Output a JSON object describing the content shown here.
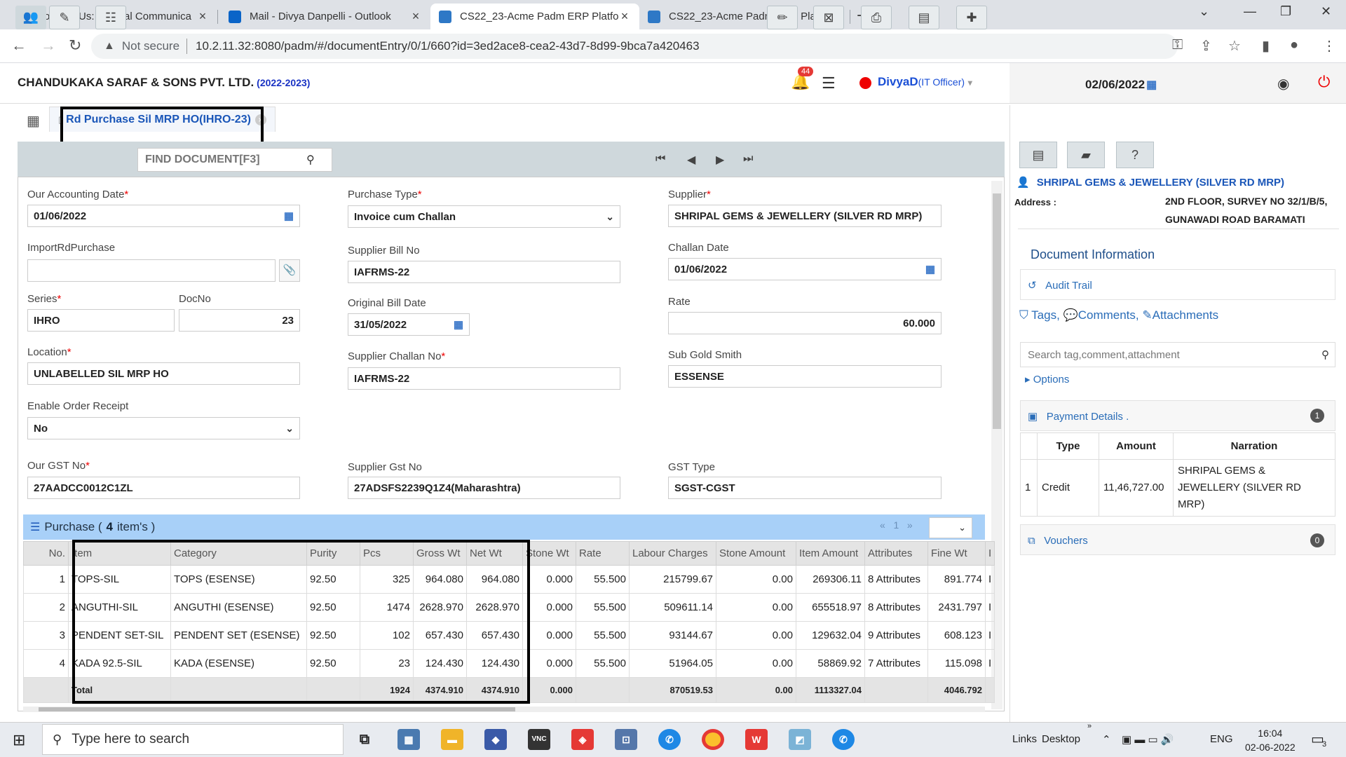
{
  "browser": {
    "tabs": [
      {
        "title": "Connect Us: Internal Communica",
        "active": false
      },
      {
        "title": "Mail - Divya Danpelli - Outlook",
        "active": false
      },
      {
        "title": "CS22_23-Acme Padm ERP Platfor",
        "active": true
      },
      {
        "title": "CS22_23-Acme Padm ERP Platfor",
        "active": false
      }
    ],
    "not_secure": "Not secure",
    "url": "10.2.11.32:8080/padm/#/documentEntry/0/1/660?id=3ed2ace8-cea2-43d7-8d99-9bca7a420463"
  },
  "header": {
    "company": "CHANDUKAKA SARAF & SONS PVT. LTD.",
    "year": "(2022-2023)",
    "notifications": "44",
    "user": "DivyaD",
    "role": "(IT Officer)",
    "date": "02/06/2022"
  },
  "doc_tab": {
    "title": "Rd Purchase Sil MRP HO(IHRO-23)"
  },
  "toolbar": {
    "find_placeholder": "FIND DOCUMENT[F3]"
  },
  "form": {
    "accounting_date_label": "Our Accounting Date",
    "accounting_date": "01/06/2022",
    "import_label": "ImportRdPurchase",
    "import_value": "",
    "series_label": "Series",
    "series": "IHRO",
    "docno_label": "DocNo",
    "docno": "23",
    "location_label": "Location",
    "location": "UNLABELLED SIL MRP HO",
    "enable_order_label": "Enable Order Receipt",
    "enable_order": "No",
    "our_gst_label": "Our GST No",
    "our_gst": "27AADCC0012C1ZL",
    "purchase_type_label": "Purchase Type",
    "purchase_type": "Invoice cum Challan",
    "supplier_bill_label": "Supplier Bill No",
    "supplier_bill": "IAFRMS-22",
    "original_bill_date_label": "Original Bill Date",
    "original_bill_date": "31/05/2022",
    "supplier_challan_label": "Supplier Challan No",
    "supplier_challan": "IAFRMS-22",
    "supplier_gst_label": "Supplier Gst No",
    "supplier_gst": "27ADSFS2239Q1Z4(Maharashtra)",
    "supplier_label": "Supplier",
    "supplier": "SHRIPAL GEMS & JEWELLERY (SILVER RD MRP)",
    "challan_date_label": "Challan Date",
    "challan_date": "01/06/2022",
    "rate_label": "Rate",
    "rate": "60.000",
    "sub_gold_smith_label": "Sub Gold Smith",
    "sub_gold_smith": "ESSENSE",
    "gst_type_label": "GST Type",
    "gst_type": "SGST-CGST"
  },
  "grid": {
    "title": "Purchase (",
    "count": "4",
    "suffix": "item's )",
    "page": "1",
    "columns": [
      "No.",
      "Item",
      "Category",
      "Purity",
      "Pcs",
      "Gross Wt",
      "Net Wt",
      "Stone Wt",
      "Rate",
      "Labour Charges",
      "Stone Amount",
      "Item Amount",
      "Attributes",
      "Fine Wt",
      "I"
    ],
    "rows": [
      [
        "1",
        "TOPS-SIL",
        "TOPS (ESENSE)",
        "92.50",
        "325",
        "964.080",
        "964.080",
        "0.000",
        "55.500",
        "215799.67",
        "0.00",
        "269306.11",
        "8 Attributes",
        "891.774",
        "I"
      ],
      [
        "2",
        "ANGUTHI-SIL",
        "ANGUTHI (ESENSE)",
        "92.50",
        "1474",
        "2628.970",
        "2628.970",
        "0.000",
        "55.500",
        "509611.14",
        "0.00",
        "655518.97",
        "8 Attributes",
        "2431.797",
        "I"
      ],
      [
        "3",
        "PENDENT SET-SIL",
        "PENDENT SET (ESENSE)",
        "92.50",
        "102",
        "657.430",
        "657.430",
        "0.000",
        "55.500",
        "93144.67",
        "0.00",
        "129632.04",
        "9 Attributes",
        "608.123",
        "I"
      ],
      [
        "4",
        "KADA 92.5-SIL",
        "KADA (ESENSE)",
        "92.50",
        "23",
        "124.430",
        "124.430",
        "0.000",
        "55.500",
        "51964.05",
        "0.00",
        "58869.92",
        "7 Attributes",
        "115.098",
        "I"
      ]
    ],
    "total": [
      "",
      "Total",
      "",
      "",
      "1924",
      "4374.910",
      "4374.910",
      "0.000",
      "",
      "870519.53",
      "0.00",
      "1113327.04",
      "",
      "4046.792",
      ""
    ]
  },
  "right_panel": {
    "supplier_name": "SHRIPAL GEMS & JEWELLERY (SILVER RD MRP)",
    "address_label": "Address :",
    "address_line1": "2ND FLOOR, SURVEY NO 32/1/B/5,",
    "address_line2": "GUNAWADI ROAD BARAMATI",
    "doc_info_title": "Document Information",
    "audit_trail": "Audit Trail",
    "tags": "Tags,",
    "comments": "Comments,",
    "attachments": "Attachments",
    "search_placeholder": "Search tag,comment,attachment",
    "options": "Options",
    "payment_details": "Payment Details .",
    "payment_count": "1",
    "payment_columns": [
      "Type",
      "Amount",
      "Narration"
    ],
    "payment_rows": [
      [
        "1",
        "Credit",
        "11,46,727.00",
        "SHRIPAL GEMS & JEWELLERY (SILVER RD MRP)"
      ]
    ],
    "vouchers": "Vouchers",
    "vouchers_count": "0"
  },
  "taskbar": {
    "search_placeholder": "Type here to search",
    "links": "Links",
    "desktop": "Desktop",
    "lang": "ENG",
    "time": "16:04",
    "date": "02-06-2022",
    "notif_count": "3"
  }
}
